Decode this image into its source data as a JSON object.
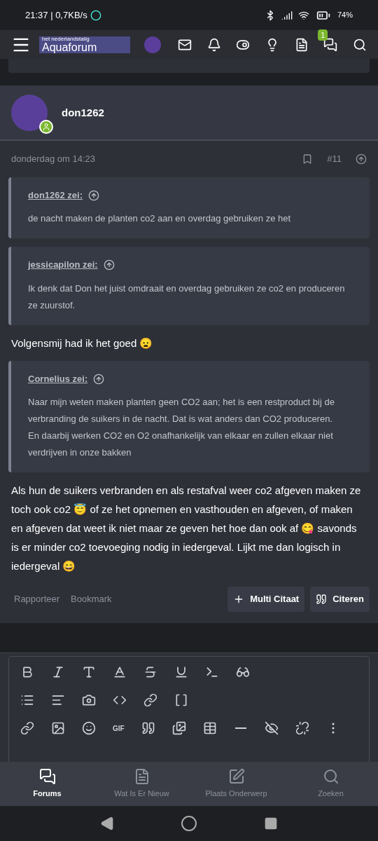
{
  "status_bar": {
    "time": "21:37 | 0,7KB/s",
    "battery": "74%"
  },
  "header": {
    "logo": "Aquaforum",
    "logo_tagline": "het nederlandstalig",
    "notification_badge": "1"
  },
  "post": {
    "author": "don1262",
    "online": true,
    "date": "donderdag om 14:23",
    "number": "#11",
    "blocks": [
      {
        "kind": "quote",
        "author": "don1262 zei:",
        "lines": [
          "de nacht maken de planten co2 aan en overdag gebruiken ze het"
        ]
      },
      {
        "kind": "quote",
        "author": "jessicapilon zei:",
        "lines": [
          "Ik denk dat Don het juist omdraait en overdag gebruiken ze co2 en produceren ze zuurstof."
        ]
      },
      {
        "kind": "text",
        "text": "Volgensmij had ik het goed 😦"
      },
      {
        "kind": "quote",
        "author": "Cornelius zei:",
        "lines": [
          "Naar mijn weten maken planten geen CO2 aan; het is een restproduct bij de verbranding de suikers in de nacht. Dat is wat anders dan CO2 produceren.",
          "En daarbij werken CO2 en O2 onafhankelijk van elkaar en zullen elkaar niet verdrijven in onze bakken"
        ]
      },
      {
        "kind": "text",
        "text": "Als hun de suikers verbranden en als restafval weer co2 afgeven maken ze toch ook co2 😇 of ze het opnemen en vasthouden en afgeven, of maken en afgeven dat weet ik niet maar ze geven het hoe dan ook af 😋 savonds is er minder co2 toevoeging nodig in iedergeval. Lijkt me dan logisch in iedergeval 😄"
      }
    ],
    "links": [
      "Rapporteer",
      "Bookmark"
    ],
    "buttons": [
      {
        "kind": "multi",
        "label": "Multi Citaat"
      },
      {
        "kind": "quote",
        "label": "Citeren"
      }
    ]
  },
  "editor": {
    "gif_label": "GIF"
  },
  "bottom_nav": [
    {
      "kind": "forums",
      "label": "Forums",
      "selected": true
    },
    {
      "kind": "new",
      "label": "Wat Is Er Nieuw",
      "selected": false
    },
    {
      "kind": "post",
      "label": "Plaats Onderwerp",
      "selected": false
    },
    {
      "kind": "search",
      "label": "Zoeken",
      "selected": false
    }
  ]
}
